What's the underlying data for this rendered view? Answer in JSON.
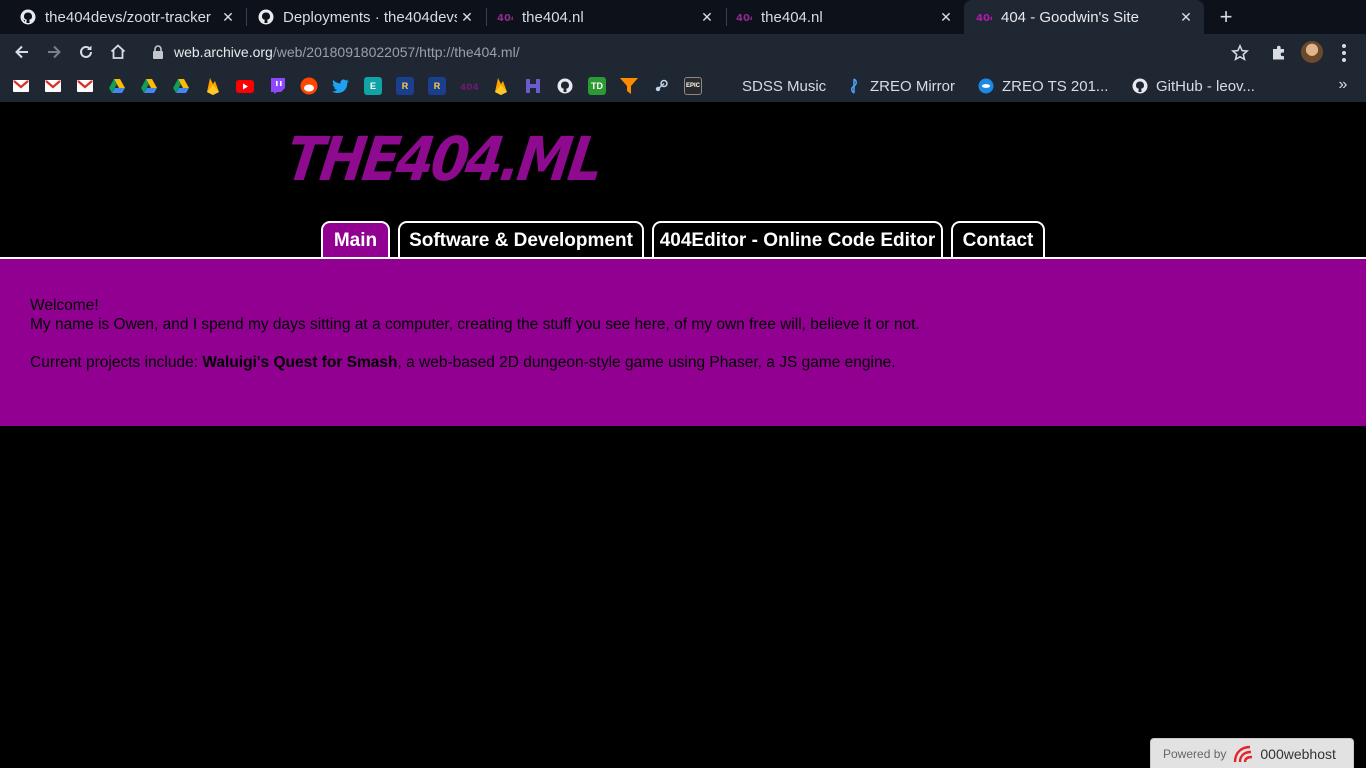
{
  "tabs": [
    {
      "title": "the404devs/zootr-tracker",
      "icon": "github-icon"
    },
    {
      "title": "Deployments · the404devs",
      "icon": "github-icon"
    },
    {
      "title": "the404.nl",
      "icon": "the404-favicon-icon"
    },
    {
      "title": "the404.nl",
      "icon": "the404-favicon-icon"
    },
    {
      "title": "404 - Goodwin's Site",
      "icon": "the404-favicon-icon",
      "active": true
    }
  ],
  "address_bar": {
    "host": "web.archive.org",
    "path": "/web/20180918022057/http://the404.ml/"
  },
  "bookmarks": {
    "icon_only": [
      "gmail-icon",
      "gmail-icon",
      "gmail-icon",
      "drive-icon",
      "drive-icon",
      "drive-icon",
      "firebase-icon",
      "youtube-icon",
      "twitch-icon",
      "reddit-icon",
      "twitter-icon",
      "e-icon",
      "r-icon",
      "r-icon",
      "the404-favicon-icon",
      "firebase-icon",
      "h-icon",
      "github-icon",
      "td-icon",
      "filter-icon",
      "steam-icon",
      "epic-icon"
    ],
    "labeled": [
      {
        "label": "SDSS Music",
        "icon": "none"
      },
      {
        "label": "ZREO Mirror",
        "icon": "music-note-icon"
      },
      {
        "label": "ZREO TS 201...",
        "icon": "teamspeak-icon"
      },
      {
        "label": "GitHub - leov...",
        "icon": "github-icon"
      }
    ]
  },
  "site": {
    "logo_text": "THE404.ML",
    "nav": [
      {
        "label": "Main",
        "active": true
      },
      {
        "label": "Software & Development"
      },
      {
        "label": "404Editor - Online Code Editor"
      },
      {
        "label": "Contact"
      }
    ],
    "welcome_line1": "Welcome!",
    "welcome_line2": "My name is Owen, and I spend my days sitting at a computer, creating the stuff you see here, of my own free will, believe it or not.",
    "projects_prefix": "Current projects include: ",
    "projects_bold": "Waluigi's Quest for Smash",
    "projects_suffix": ", a web-based 2D dungeon-style game using Phaser, a JS game engine.",
    "colors": {
      "accent": "#910091",
      "logo": "#8e0a8e",
      "background": "#000000"
    }
  },
  "footer_badge": {
    "prefix": "Powered by",
    "brand": "000webhost"
  }
}
